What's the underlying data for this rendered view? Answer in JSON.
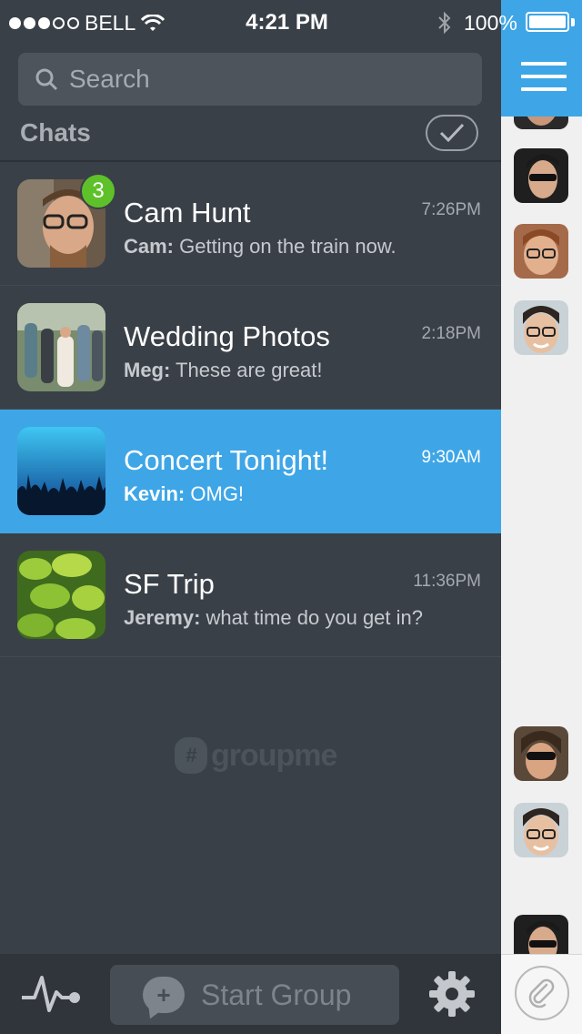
{
  "status_bar": {
    "carrier": "BELL",
    "time": "4:21 PM",
    "battery": "100%"
  },
  "search": {
    "placeholder": "Search"
  },
  "chats": {
    "title": "Chats",
    "items": [
      {
        "name": "Cam Hunt",
        "time": "7:26PM",
        "sender": "Cam:",
        "message": "Getting on the train now.",
        "unread": "3"
      },
      {
        "name": "Wedding Photos",
        "time": "2:18PM",
        "sender": "Meg:",
        "message": "These are great!"
      },
      {
        "name": "Concert Tonight!",
        "time": "9:30AM",
        "sender": "Kevin:",
        "message": "OMG!"
      },
      {
        "name": "SF Trip",
        "time": "11:36PM",
        "sender": "Jeremy:",
        "message": "what time do you get in?"
      }
    ]
  },
  "logo": {
    "text": "groupme"
  },
  "bottom_bar": {
    "start_group_label": "Start Group"
  },
  "colors": {
    "accent": "#3ea6e7",
    "background": "#3a4048",
    "badge": "#5fc12a"
  },
  "icons": [
    "search-icon",
    "checkmark-icon",
    "activity-icon",
    "chat-plus-icon",
    "gear-icon",
    "menu-icon",
    "paperclip-icon"
  ]
}
